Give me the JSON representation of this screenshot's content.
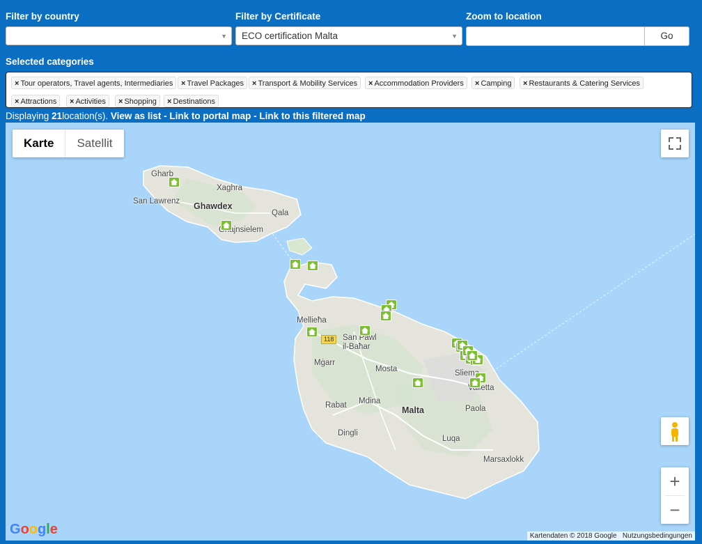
{
  "filters": {
    "country_label": "Filter by country",
    "country_value": "",
    "certificate_label": "Filter by Certificate",
    "certificate_value": "ECO certification Malta",
    "zoom_label": "Zoom to location",
    "zoom_value": "",
    "go_label": "Go"
  },
  "categories": {
    "label": "Selected categories",
    "remove_glyph": "×",
    "items": [
      "Tour operators, Travel agents, Intermediaries",
      "Travel Packages",
      "Transport & Mobility Services",
      "Accommodation Providers",
      "Camping",
      "Restaurants & Catering Services",
      "Attractions",
      "Activities",
      "Shopping",
      "Destinations"
    ]
  },
  "display": {
    "prefix": "Displaying ",
    "count": "21",
    "suffix": "location(s).",
    "view_list": "View as list",
    "sep": " - ",
    "portal_map": "Link to portal map",
    "filtered_map": "Link to this filtered map"
  },
  "map": {
    "type_map": "Karte",
    "type_satellite": "Satellit",
    "fullscreen_icon": "fullscreen-icon",
    "pegman_icon": "pegman-icon",
    "zoom_in": "+",
    "zoom_out": "−",
    "attribution_data": "Kartendaten © 2018 Google",
    "attribution_terms": "Nutzungsbedingungen",
    "logo": "Google",
    "road_badge": "118",
    "marker_icon": "house-icon",
    "marker_color": "#7bbf32",
    "places": {
      "gharb": "Gharb",
      "xaghra": "Xaghra",
      "san_lawrenz": "San Lawrenz",
      "ghawdex": "Ghawdex",
      "qala": "Qala",
      "ghajnsielem": "Għajnsielem",
      "mellieha": "Mellieħa",
      "san_pawl": "San Pawl\nil-Baħar",
      "mgarr": "Mġarr",
      "mosta": "Mosta",
      "sliema": "Sliema",
      "valletta": "Valletta",
      "rabat": "Rabat",
      "mdina": "Mdina",
      "malta": "Malta",
      "paola": "Paola",
      "dingli": "Dingli",
      "luqa": "Luqa",
      "marsaxlokk": "Marsaxlokk"
    }
  }
}
